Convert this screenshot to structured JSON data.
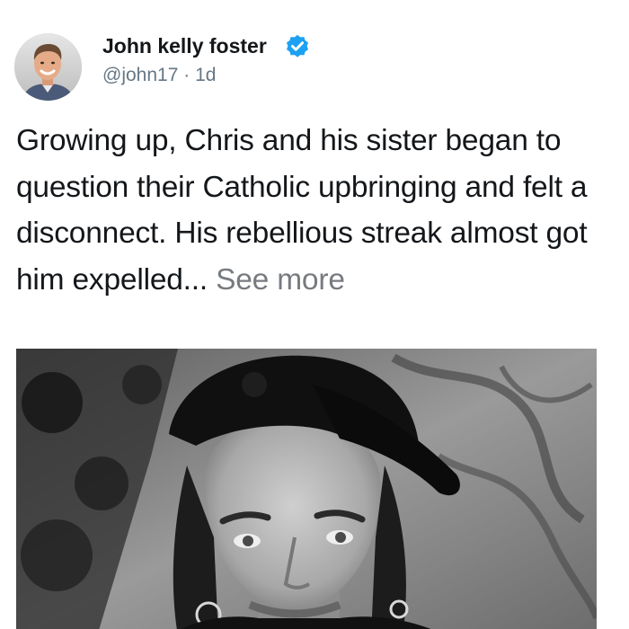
{
  "tweet": {
    "author": {
      "display_name": "John kelly foster",
      "handle": "@john17",
      "separator": "·",
      "age": "1d",
      "verified": true
    },
    "text": "Growing up, Chris and his sister began to question their Catholic upbringing and felt a disconnect. His rebellious streak almost got him expelled...",
    "see_more_label": "See more",
    "icons": {
      "avatar": "profile-photo",
      "verified": "verified-badge-icon"
    },
    "colors": {
      "text": "#14171a",
      "secondary": "#657786",
      "see_more": "#777b80",
      "verified": "#1da1f2"
    },
    "media": {
      "kind": "photo",
      "style": "black-and-white portrait"
    }
  }
}
